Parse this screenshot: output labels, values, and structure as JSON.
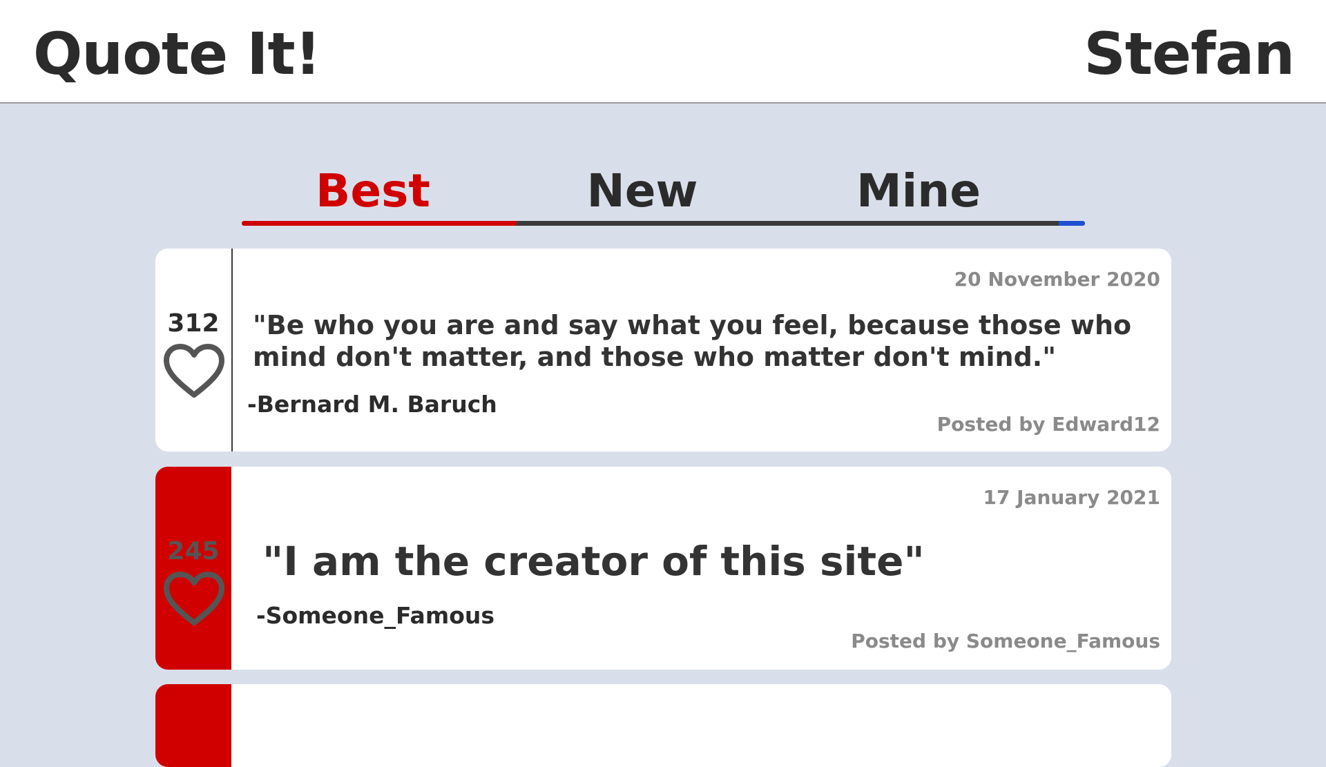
{
  "header": {
    "app_title": "Quote It!",
    "user_name": "Stefan"
  },
  "tabs": [
    {
      "label": "Best",
      "active": true
    },
    {
      "label": "New",
      "active": false
    },
    {
      "label": "Mine",
      "active": false
    }
  ],
  "colors": {
    "accent": "#d10000",
    "background": "#d9dfea",
    "card": "#ffffff",
    "text": "#2b2b2b",
    "muted": "#8a8a8a",
    "tab_end": "#1f4fd1"
  },
  "quotes": [
    {
      "likes": "312",
      "liked": false,
      "date": "20 November 2020",
      "text": "\"Be who you are and say what you feel, because those who mind don't matter, and those who matter don't mind.\"",
      "author": "-Bernard M. Baruch",
      "posted_by": "Posted by Edward12",
      "icon": "heart-outline-icon"
    },
    {
      "likes": "245",
      "liked": true,
      "date": "17 January 2021",
      "text": "\"I am the creator of this site\"",
      "author": "-Someone_Famous",
      "posted_by": "Posted by Someone_Famous",
      "icon": "heart-outline-icon"
    },
    {
      "liked": true
    }
  ]
}
